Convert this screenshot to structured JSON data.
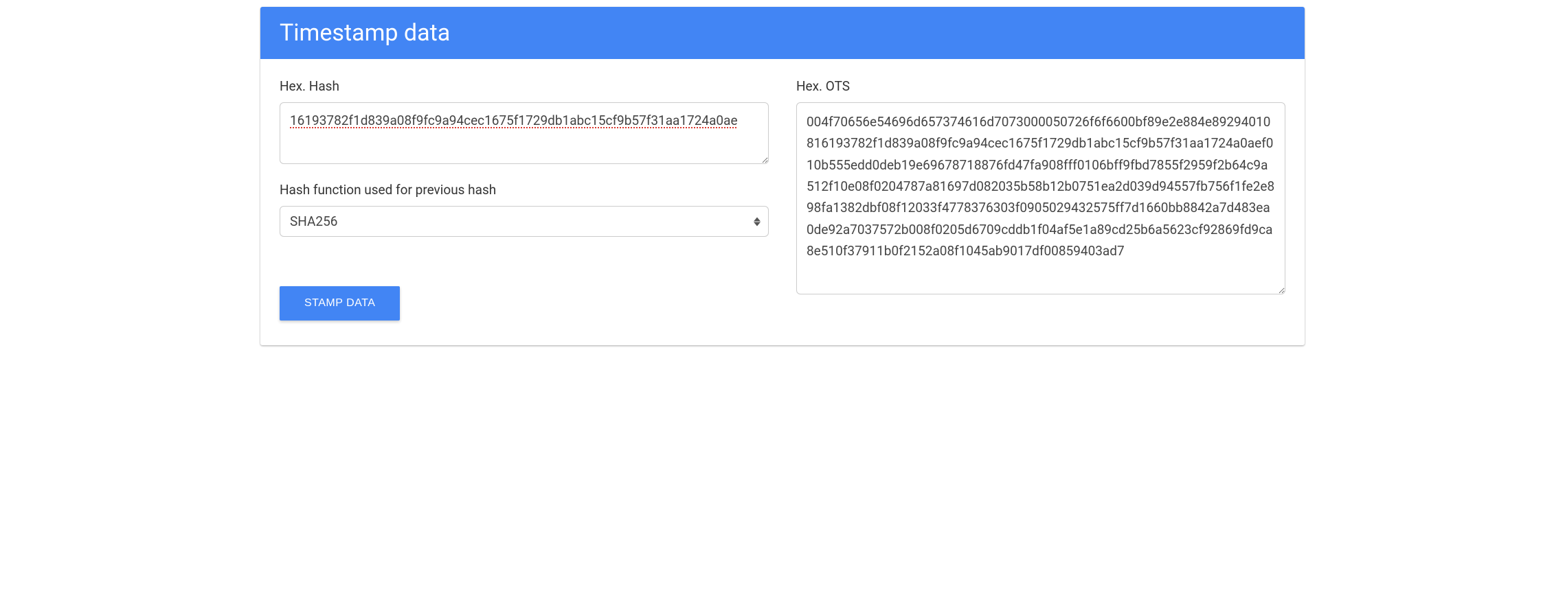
{
  "header": {
    "title": "Timestamp data"
  },
  "left": {
    "hex_hash_label": "Hex. Hash",
    "hex_hash_value": "16193782f1d839a08f9fc9a94cec1675f1729db1abc15cf9b57f31aa1724a0ae",
    "hash_function_label": "Hash function used for previous hash",
    "hash_function_selected": "SHA256",
    "stamp_button_label": "STAMP DATA"
  },
  "right": {
    "hex_ots_label": "Hex. OTS",
    "hex_ots_value": "004f70656e54696d657374616d7073000050726f6f6600bf89e2e884e8929401081619378​2f1d839a08f9fc9a94cec1675f1729db1abc15cf9b57f31aa1724a0aef010b555edd0deb19e69678718876fd47fa908fff0106bff9fbd7855f2959f2b64c9a512f10e08f0204787a81697d082035b58b12b0751ea2d039d94557fb756f1fe2e898fa1382dbf08f12033f4778376303f0905029432575ff7d1660bb8842a7d483ea0de92a7037572b008f0205d6709cddb1f04af5e1a89cd25b6a5623cf92869fd9ca8e510f37911b0f2152a08f1045ab9017df00859403ad7"
  }
}
